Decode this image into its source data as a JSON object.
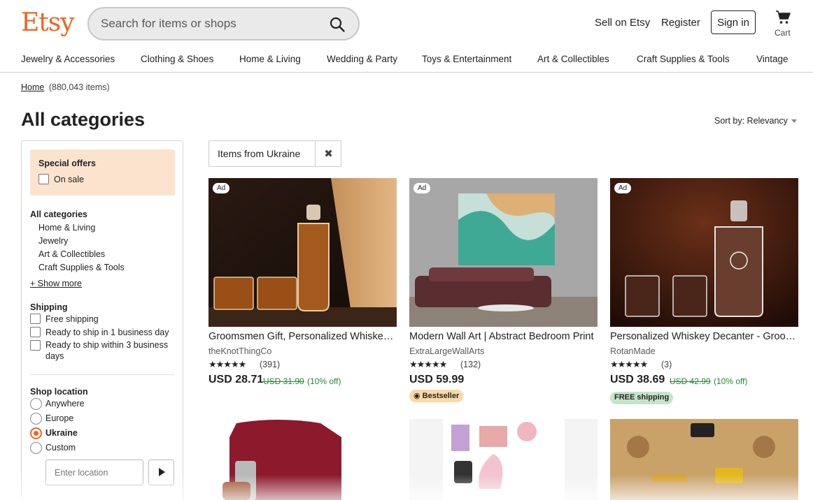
{
  "brand": {
    "logo": "Etsy",
    "color": "#F1641E"
  },
  "search": {
    "placeholder": "Search for items or shops",
    "value": ""
  },
  "header": {
    "sell_label": "Sell on Etsy",
    "register_label": "Register",
    "signin_label": "Sign in",
    "cart_label": "Cart"
  },
  "categories_nav": [
    "Jewelry & Accessories",
    "Clothing & Shoes",
    "Home & Living",
    "Wedding & Party",
    "Toys & Entertainment",
    "Art & Collectibles",
    "Craft Supplies & Tools",
    "Vintage"
  ],
  "breadcrumb": {
    "home": "Home",
    "count": "(880,043 items)"
  },
  "page_title": "All categories",
  "sort": {
    "label": "Sort by: Relevancy"
  },
  "filters": {
    "special_offers_title": "Special offers",
    "on_sale_label": "On sale",
    "all_categories_title": "All categories",
    "categories": [
      "Home & Living",
      "Jewelry",
      "Art & Collectibles",
      "Craft Supplies & Tools"
    ],
    "show_more": "+ Show more",
    "shipping_title": "Shipping",
    "shipping_options": [
      "Free shipping",
      "Ready to ship in 1 business day",
      "Ready to ship within 3 business days"
    ],
    "shop_location_title": "Shop location",
    "locations": [
      {
        "label": "Anywhere",
        "selected": false
      },
      {
        "label": "Europe",
        "selected": false
      },
      {
        "label": "Ukraine",
        "selected": true
      },
      {
        "label": "Custom",
        "selected": false
      }
    ],
    "location_placeholder": "Enter location"
  },
  "active_filter": {
    "label": "Items from Ukraine"
  },
  "listings": [
    {
      "ad": "Ad",
      "title": "Groomsmen Gift, Personalized Whiskey Decanter Set",
      "shop": "theKnotThingCo",
      "stars": "★★★★★",
      "rating": 4.5,
      "reviews": "(391)",
      "price": "USD 28.71",
      "original_price": "USD 31.90",
      "discount": "(10% off)"
    },
    {
      "ad": "Ad",
      "title": "Modern Wall Art | Abstract Bedroom Print",
      "shop": "ExtraLargeWallArts",
      "stars": "★★★★★",
      "rating": 5,
      "reviews": "(132)",
      "price": "USD 59.99",
      "badge": "Bestseller"
    },
    {
      "ad": "Ad",
      "title": "Personalized Whiskey Decanter - Groomsmen Gift",
      "shop": "RotanMade",
      "stars": "★★★★★",
      "rating": 5,
      "reviews": "(3)",
      "price": "USD 38.69",
      "original_price": "USD 42.99",
      "discount": "(10% off)",
      "badge": "FREE shipping"
    }
  ]
}
